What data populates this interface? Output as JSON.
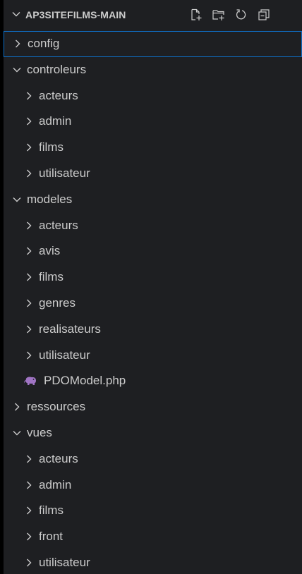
{
  "explorer": {
    "title": "AP3SITEFILMS-MAIN",
    "actions": [
      {
        "name": "new-file-icon"
      },
      {
        "name": "new-folder-icon"
      },
      {
        "name": "refresh-icon"
      },
      {
        "name": "collapse-all-icon"
      }
    ],
    "rows": [
      {
        "label": "config",
        "type": "folder",
        "expanded": false,
        "level": 0,
        "selected": true
      },
      {
        "label": "controleurs",
        "type": "folder",
        "expanded": true,
        "level": 0
      },
      {
        "label": "acteurs",
        "type": "folder",
        "expanded": false,
        "level": 1
      },
      {
        "label": "admin",
        "type": "folder",
        "expanded": false,
        "level": 1
      },
      {
        "label": "films",
        "type": "folder",
        "expanded": false,
        "level": 1
      },
      {
        "label": "utilisateur",
        "type": "folder",
        "expanded": false,
        "level": 1
      },
      {
        "label": "modeles",
        "type": "folder",
        "expanded": true,
        "level": 0
      },
      {
        "label": "acteurs",
        "type": "folder",
        "expanded": false,
        "level": 1
      },
      {
        "label": "avis",
        "type": "folder",
        "expanded": false,
        "level": 1
      },
      {
        "label": "films",
        "type": "folder",
        "expanded": false,
        "level": 1
      },
      {
        "label": "genres",
        "type": "folder",
        "expanded": false,
        "level": 1
      },
      {
        "label": "realisateurs",
        "type": "folder",
        "expanded": false,
        "level": 1
      },
      {
        "label": "utilisateur",
        "type": "folder",
        "expanded": false,
        "level": 1
      },
      {
        "label": "PDOModel.php",
        "type": "file",
        "icon": "php-elephant-icon",
        "level": 1
      },
      {
        "label": "ressources",
        "type": "folder",
        "expanded": false,
        "level": 0
      },
      {
        "label": "vues",
        "type": "folder",
        "expanded": true,
        "level": 0
      },
      {
        "label": "acteurs",
        "type": "folder",
        "expanded": false,
        "level": 1
      },
      {
        "label": "admin",
        "type": "folder",
        "expanded": false,
        "level": 1
      },
      {
        "label": "films",
        "type": "folder",
        "expanded": false,
        "level": 1
      },
      {
        "label": "front",
        "type": "folder",
        "expanded": false,
        "level": 1
      },
      {
        "label": "utilisateur",
        "type": "folder",
        "expanded": false,
        "level": 1
      }
    ]
  },
  "colors": {
    "background": "#1e1f22",
    "text": "#cccccc",
    "selection_border": "#0e6fc7",
    "php_icon": "#a074c4"
  }
}
